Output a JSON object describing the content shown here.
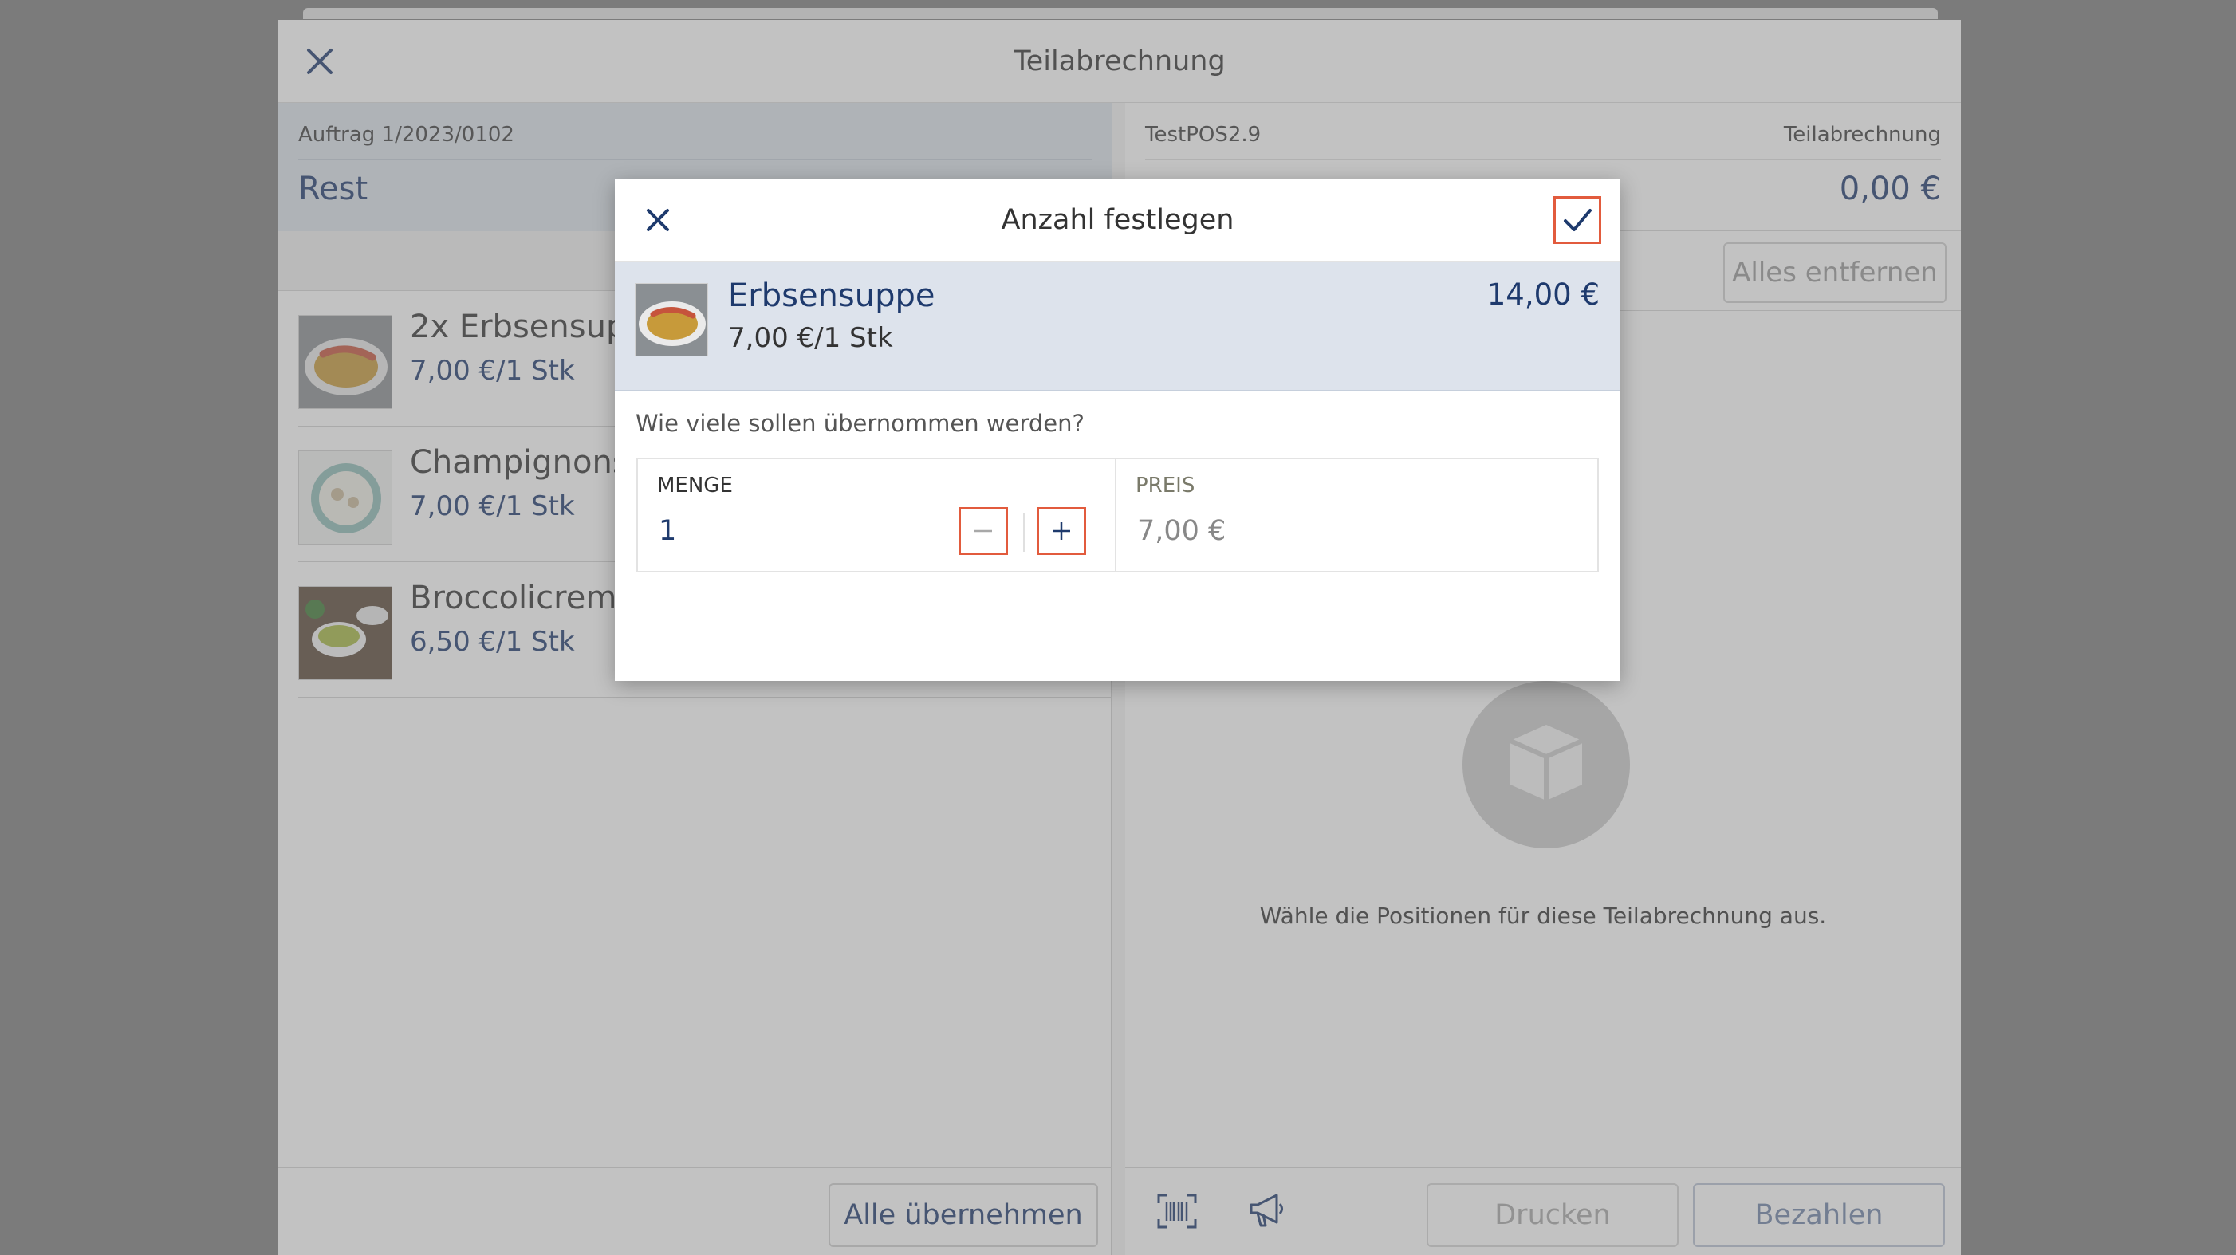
{
  "window": {
    "title": "Teilabrechnung"
  },
  "left_pane": {
    "order_label": "Auftrag 1/2023/0102",
    "rest_label": "Rest",
    "items": [
      {
        "name": "2x Erbsensuppe",
        "price": "7,00 €/1 Stk"
      },
      {
        "name": "Champignonsuppe",
        "price": "7,00 €/1 Stk"
      },
      {
        "name": "Broccolicremesuppe",
        "price": "6,50 €/1 Stk"
      }
    ],
    "take_all_label": "Alle übernehmen"
  },
  "right_pane": {
    "register_label": "TestPOS2.9",
    "sub_label": "Teilabrechnung",
    "total": "0,00 €",
    "remove_all_label": "Alles entfernen",
    "empty_text": "Wähle die Positionen für diese Teilabrechnung aus.",
    "print_label": "Drucken",
    "pay_label": "Bezahlen"
  },
  "modal": {
    "title": "Anzahl festlegen",
    "item_name": "Erbsensuppe",
    "item_unit_price": "7,00 €/1 Stk",
    "item_total": "14,00 €",
    "question": "Wie viele sollen übernommen werden?",
    "quantity_label": "MENGE",
    "quantity_value": "1",
    "price_label": "PREIS",
    "price_value": "7,00 €"
  },
  "colors": {
    "brand_blue": "#1e3a6d",
    "highlight": "#e25b3d",
    "header_band": "#dde3ec"
  },
  "icons": [
    "close-icon",
    "checkmark-icon",
    "minus-icon",
    "plus-icon",
    "barcode-icon",
    "megaphone-icon",
    "box-icon"
  ]
}
